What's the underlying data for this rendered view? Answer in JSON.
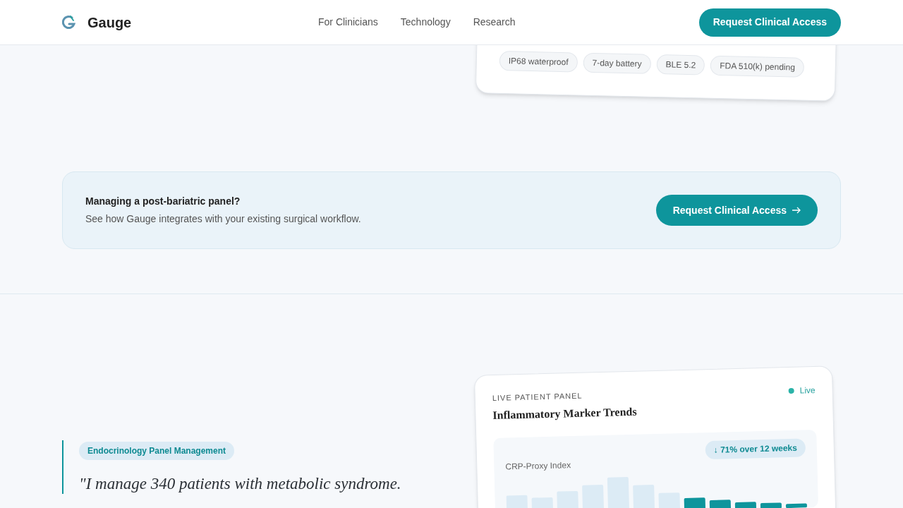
{
  "header": {
    "brand": "Gauge",
    "nav": [
      "For Clinicians",
      "Technology",
      "Research"
    ],
    "cta": "Request Clinical Access"
  },
  "device_card": {
    "tags": [
      "IP68 waterproof",
      "7-day battery",
      "BLE 5.2",
      "FDA 510(k) pending"
    ]
  },
  "banner": {
    "title": "Managing a post-bariatric panel?",
    "text": "See how Gauge integrates with your existing surgical workflow.",
    "button": "Request Clinical Access"
  },
  "testimonial": {
    "tag": "Endocrinology Panel Management",
    "quote_lines": [
      "\"I manage 340 patients with metabolic syndrome."
    ]
  },
  "panel_card": {
    "eyebrow": "LIVE PATIENT PANEL",
    "title": "Inflammatory Marker Trends",
    "status": {
      "label": "Live",
      "color": "#2bb3a8"
    },
    "metric": "CRP-Proxy Index",
    "change": "↓ 71% over 12 weeks"
  }
}
